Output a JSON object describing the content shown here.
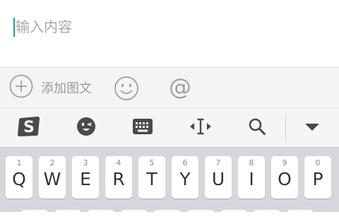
{
  "composer": {
    "placeholder": "输入内容"
  },
  "attach_bar": {
    "add_label": "添加图文"
  },
  "ime_toolbar": {
    "tools": [
      "sogou-logo",
      "emoji",
      "keyboard",
      "cursor-move",
      "search",
      "collapse"
    ]
  },
  "keyboard": {
    "row1": [
      {
        "num": "1",
        "ch": "Q"
      },
      {
        "num": "2",
        "ch": "W"
      },
      {
        "num": "3",
        "ch": "E"
      },
      {
        "num": "4",
        "ch": "R"
      },
      {
        "num": "5",
        "ch": "T"
      },
      {
        "num": "6",
        "ch": "Y"
      },
      {
        "num": "7",
        "ch": "U"
      },
      {
        "num": "8",
        "ch": "I"
      },
      {
        "num": "9",
        "ch": "O"
      },
      {
        "num": "0",
        "ch": "P"
      }
    ]
  },
  "colors": {
    "caret": "#1ba08f",
    "toolbar_icon": "#9b9b9b",
    "ime_icon": "#555555",
    "keyboard_bg": "#d6d7dc"
  }
}
